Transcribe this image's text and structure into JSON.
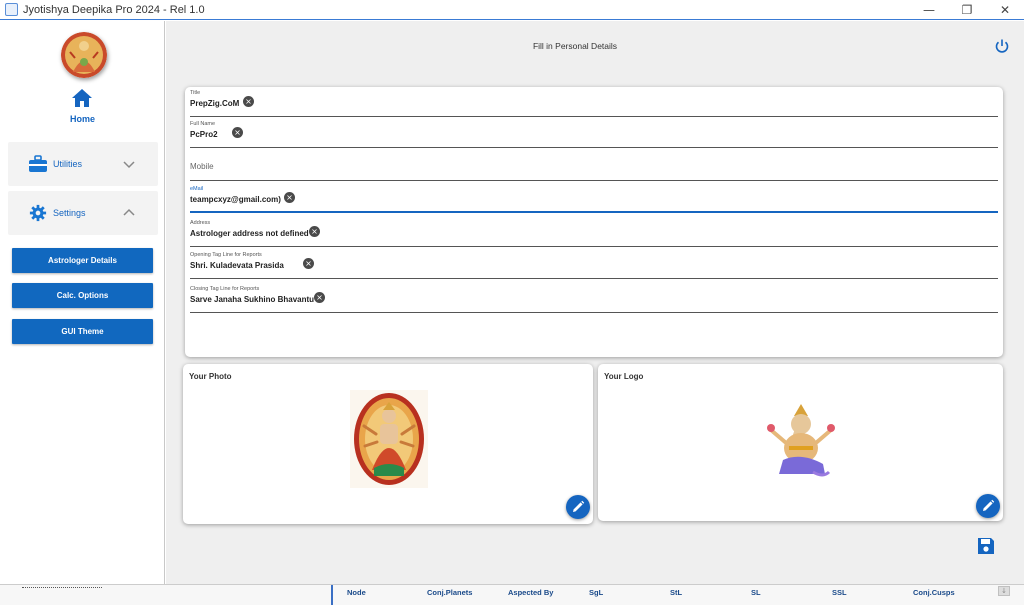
{
  "window": {
    "title": "Jyotishya Deepika Pro 2024 - Rel 1.0",
    "minimize": "—",
    "restore": "❐",
    "close": "✕"
  },
  "sidebar": {
    "home_label": "Home",
    "sections": [
      {
        "label": "Utilities",
        "icon": "toolbox-icon",
        "expanded": false
      },
      {
        "label": "Settings",
        "icon": "gear-icon",
        "expanded": true
      }
    ],
    "buttons": [
      "Astrologer Details",
      "Calc. Options",
      "GUI Theme"
    ]
  },
  "main": {
    "page_title": "Fill in Personal Details",
    "fields": [
      {
        "label": "Title",
        "value": "PrepZig.CoM"
      },
      {
        "label": "Full Name",
        "value": "PcPro2"
      },
      {
        "label": "",
        "placeholder": "Mobile",
        "value": ""
      },
      {
        "label": "eMail",
        "value": "teampcxyz@gmail.com)",
        "focused": true
      },
      {
        "label": "Address",
        "value": "Astrologer address not defined"
      },
      {
        "label": "Opening Tag Line for Reports",
        "value": "Shri. Kuladevata Prasida"
      },
      {
        "label": "Closing Tag Line for Reports",
        "value": "Sarve Janaha Sukhino Bhavantu"
      }
    ],
    "clear_glyph": "×",
    "photo_card_title": "Your Photo",
    "logo_card_title": "Your Logo"
  },
  "statusbar": {
    "columns": [
      "Node",
      "Conj.Planets",
      "Aspected By",
      "SgL",
      "StL",
      "SL",
      "SSL",
      "Conj.Cusps"
    ],
    "scroll_glyph": "↓"
  },
  "colors": {
    "accent": "#1565c0",
    "button_bg": "#1168bf",
    "main_bg": "#efefef"
  }
}
